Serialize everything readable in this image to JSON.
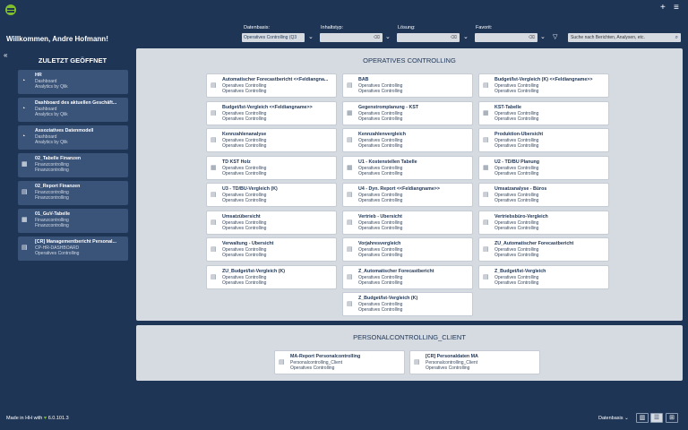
{
  "header": {
    "welcome": "Willkommen, Andre Hofmann!",
    "filters": [
      {
        "label": "Datenbasis:",
        "value": "Operatives Controlling (Q3"
      },
      {
        "label": "Inhaltstyp:",
        "value": ""
      },
      {
        "label": "Lösung:",
        "value": ""
      },
      {
        "label": "Favorit:",
        "value": ""
      }
    ],
    "search_placeholder": "Suche nach Berichten, Analysen, etc."
  },
  "sidebar": {
    "title": "ZULETZT GEÖFFNET",
    "items": [
      {
        "title": "HR",
        "line1": "Dashboard",
        "line2": "Analytics by Qlik",
        "icon": "dashboard-icon"
      },
      {
        "title": "Dashboard des aktuellen Geschäft...",
        "line1": "Dashboard",
        "line2": "Analytics by Qlik",
        "icon": "dashboard-icon"
      },
      {
        "title": "Assoziatives Datenmodell",
        "line1": "Dashboard",
        "line2": "Analytics by Qlik",
        "icon": "dashboard-icon"
      },
      {
        "title": "02_Tabelle Finanzen",
        "line1": "Finanzcontrolling",
        "line2": "Finanzcontrolling",
        "icon": "table-icon"
      },
      {
        "title": "02_Report Finanzen",
        "line1": "Finanzcontrolling",
        "line2": "Finanzcontrolling",
        "icon": "report-icon"
      },
      {
        "title": "01_GuV-Tabelle",
        "line1": "Finanzcontrolling",
        "line2": "Finanzcontrolling",
        "icon": "table-icon"
      },
      {
        "title": "[CR] Managementbericht Personal...",
        "line1": "CP-HR-DASHBOARD",
        "line2": "Operatives Controlling",
        "icon": "report-icon"
      }
    ]
  },
  "sections": [
    {
      "title": "OPERATIVES CONTROLLING",
      "cards": [
        {
          "title": "Automatischer Forecastbericht <<Feldiangna...",
          "line1": "Operatives Controlling",
          "line2": "Operatives Controlling",
          "icon": "report-icon"
        },
        {
          "title": "BAB",
          "line1": "Operatives Controlling",
          "line2": "Operatives Controlling",
          "icon": "report-icon"
        },
        {
          "title": "Budget/Ist-Vergleich (K) <<Feldiangname>>",
          "line1": "Operatives Controlling",
          "line2": "Operatives Controlling",
          "icon": "report-icon"
        },
        {
          "title": "Budget/Ist-Vergleich <<Feldiangname>>",
          "line1": "Operatives Controlling",
          "line2": "Operatives Controlling",
          "icon": "report-icon"
        },
        {
          "title": "Gegenstromplanung - KST",
          "line1": "Operatives Controlling",
          "line2": "Operatives Controlling",
          "icon": "table-icon"
        },
        {
          "title": "KST-Tabelle",
          "line1": "Operatives Controlling",
          "line2": "Operatives Controlling",
          "icon": "table-icon"
        },
        {
          "title": "Kennzahlenanalyse",
          "line1": "Operatives Controlling",
          "line2": "Operatives Controlling",
          "icon": "report-icon"
        },
        {
          "title": "Kennzahlenvergleich",
          "line1": "Operatives Controlling",
          "line2": "Operatives Controlling",
          "icon": "report-icon"
        },
        {
          "title": "Produktion-Übersicht",
          "line1": "Operatives Controlling",
          "line2": "Operatives Controlling",
          "icon": "report-icon"
        },
        {
          "title": "TD KST Holz",
          "line1": "Operatives Controlling",
          "line2": "Operatives Controlling",
          "icon": "table-icon"
        },
        {
          "title": "U1 - Kostenstellen Tabelle",
          "line1": "Operatives Controlling",
          "line2": "Operatives Controlling",
          "icon": "table-icon"
        },
        {
          "title": "U2 - TD/BU Planung",
          "line1": "Operatives Controlling",
          "line2": "Operatives Controlling",
          "icon": "table-icon"
        },
        {
          "title": "U3 - TD/BU-Vergleich (K)",
          "line1": "Operatives Controlling",
          "line2": "Operatives Controlling",
          "icon": "report-icon"
        },
        {
          "title": "U4 - Dyn. Report <<Feldiangname>>",
          "line1": "Operatives Controlling",
          "line2": "Operatives Controlling",
          "icon": "report-icon"
        },
        {
          "title": "Umsatzanalyse - Büros",
          "line1": "Operatives Controlling",
          "line2": "Operatives Controlling",
          "icon": "report-icon"
        },
        {
          "title": "Umsatzübersicht",
          "line1": "Operatives Controlling",
          "line2": "Operatives Controlling",
          "icon": "report-icon"
        },
        {
          "title": "Vertrieb - Übersicht",
          "line1": "Operatives Controlling",
          "line2": "Operatives Controlling",
          "icon": "report-icon"
        },
        {
          "title": "Vertriebsbüro-Vergleich",
          "line1": "Operatives Controlling",
          "line2": "Operatives Controlling",
          "icon": "report-icon"
        },
        {
          "title": "Verwaltung - Übersicht",
          "line1": "Operatives Controlling",
          "line2": "Operatives Controlling",
          "icon": "report-icon"
        },
        {
          "title": "Vorjahresvergleich",
          "line1": "Operatives Controlling",
          "line2": "Operatives Controlling",
          "icon": "report-icon"
        },
        {
          "title": "ZU_Automatischer Forecastbericht",
          "line1": "Operatives Controlling",
          "line2": "Operatives Controlling",
          "icon": "report-icon"
        },
        {
          "title": "ZU_Budget/Ist-Vergleich (K)",
          "line1": "Operatives Controlling",
          "line2": "Operatives Controlling",
          "icon": "report-icon"
        },
        {
          "title": "Z_Automatischer Forecastbericht",
          "line1": "Operatives Controlling",
          "line2": "Operatives Controlling",
          "icon": "report-icon"
        },
        {
          "title": "Z_Budget/Ist-Vergleich",
          "line1": "Operatives Controlling",
          "line2": "Operatives Controlling",
          "icon": "report-icon"
        },
        {
          "title": "Z_Budget/Ist-Vergleich (K)",
          "line1": "Operatives Controlling",
          "line2": "Operatives Controlling",
          "icon": "report-icon"
        }
      ]
    },
    {
      "title": "PERSONALCONTROLLING_CLIENT",
      "cards": [
        {
          "title": "MA-Report Personalcontrolling",
          "line1": "Personalcontrolling_Client",
          "line2": "Operatives Controlling",
          "icon": "report-icon"
        },
        {
          "title": "[CR] Personaldaten MA",
          "line1": "Personalcontrolling_Client",
          "line2": "Operatives Controlling",
          "icon": "report-icon"
        }
      ]
    }
  ],
  "footer": {
    "made_in": "Made in HH with",
    "version": "6.0.101.3",
    "sort_label": "Datenbasis"
  }
}
